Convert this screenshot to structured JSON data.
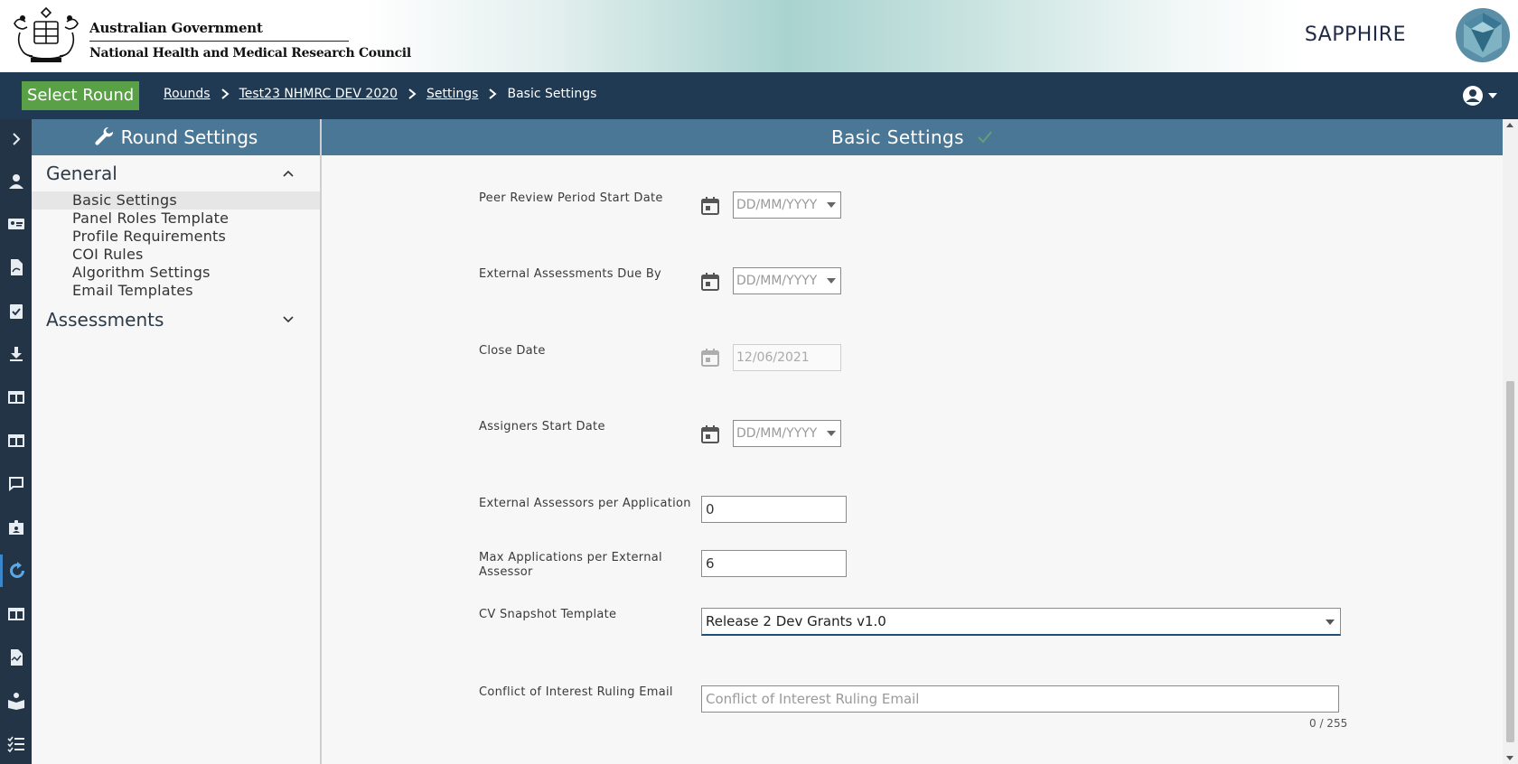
{
  "header": {
    "gov_line1": "Australian Government",
    "gov_line2": "National Health and Medical Research Council",
    "brand": "SAPPHIRE"
  },
  "navbar": {
    "select_round_label": "Select Round",
    "breadcrumbs": [
      "Rounds",
      "Test23 NHMRC DEV 2020",
      "Settings"
    ],
    "current": "Basic Settings"
  },
  "rail": {
    "icons": [
      "expand-chevron-icon",
      "users-icon",
      "id-card-icon",
      "document-icon",
      "clipboard-check-icon",
      "download-icon",
      "table-layout-icon",
      "table-layout-icon",
      "comment-icon",
      "badge-icon",
      "refresh-icon",
      "table-layout-icon",
      "chart-file-icon",
      "reading-icon",
      "checklist-icon"
    ],
    "active_index": 10
  },
  "sidebar": {
    "title": "Round Settings",
    "groups": [
      {
        "label": "General",
        "expanded": true,
        "items": [
          "Basic Settings",
          "Panel Roles Template",
          "Profile Requirements",
          "COI Rules",
          "Algorithm Settings",
          "Email Templates"
        ]
      },
      {
        "label": "Assessments",
        "expanded": false,
        "items": []
      }
    ],
    "active_item": "Basic Settings"
  },
  "main": {
    "title": "Basic Settings",
    "fields": {
      "peer_review_start": {
        "label": "Peer Review Period Start Date",
        "placeholder": "DD/MM/YYYY"
      },
      "external_due": {
        "label": "External Assessments Due By",
        "placeholder": "DD/MM/YYYY"
      },
      "close_date": {
        "label": "Close Date",
        "value": "12/06/2021"
      },
      "assigners_start": {
        "label": "Assigners Start Date",
        "placeholder": "DD/MM/YYYY"
      },
      "assessors_per_app": {
        "label": "External Assessors per Application",
        "value": "0"
      },
      "max_apps": {
        "label": "Max Applications per External Assessor",
        "value": "6"
      },
      "cv_template": {
        "label": "CV Snapshot Template",
        "value": "Release 2 Dev Grants v1.0"
      },
      "coi_email": {
        "label": "Conflict of Interest Ruling Email",
        "placeholder": "Conflict of Interest Ruling Email",
        "counter": "0 / 255"
      }
    }
  },
  "colors": {
    "navbar": "#1f3a52",
    "panel_header": "#4a7796",
    "select_round": "#5aa046",
    "rail": "#243447"
  }
}
